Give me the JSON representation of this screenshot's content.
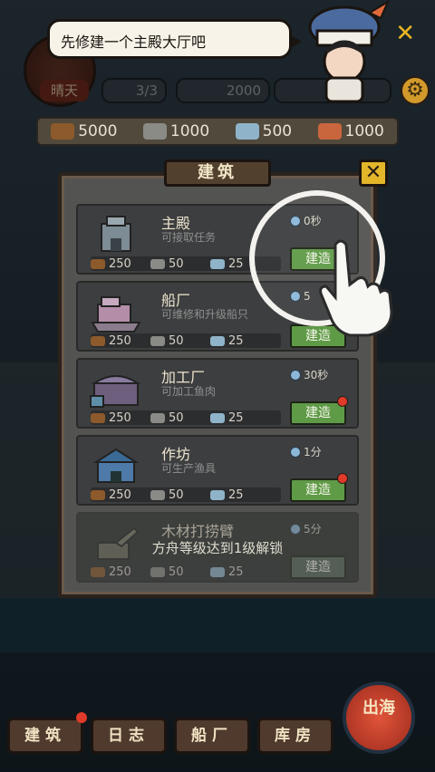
{
  "hud": {
    "weather": "晴天",
    "pill_values": [
      "3/3",
      "2000"
    ]
  },
  "resources": [
    {
      "icon": "wood-icon",
      "value": "5000"
    },
    {
      "icon": "stone-icon",
      "value": "1000"
    },
    {
      "icon": "iron-icon",
      "value": "500"
    },
    {
      "icon": "meat-icon",
      "value": "1000"
    }
  ],
  "tutorial": {
    "bubble_text": "先修建一个主殿大厅吧"
  },
  "panel": {
    "title": "建筑",
    "close_symbol": "✕",
    "locked_message": "方舟等级达到1级解锁",
    "buildings": [
      {
        "name": "主殿",
        "desc": "可接取任务",
        "time": "0秒",
        "wood": "250",
        "stone": "50",
        "iron": "25",
        "button": "建造"
      },
      {
        "name": "船厂",
        "desc": "可维修和升级船只",
        "time": "5",
        "wood": "250",
        "stone": "50",
        "iron": "25",
        "button": "建造"
      },
      {
        "name": "加工厂",
        "desc": "可加工鱼肉",
        "time": "30秒",
        "wood": "250",
        "stone": "50",
        "iron": "25",
        "button": "建造"
      },
      {
        "name": "作坊",
        "desc": "可生产渔具",
        "time": "1分",
        "wood": "250",
        "stone": "50",
        "iron": "25",
        "button": "建造"
      },
      {
        "name": "木材打捞臂",
        "desc": "",
        "time": "5分",
        "wood": "250",
        "stone": "50",
        "iron": "25",
        "button": "建造"
      }
    ]
  },
  "nav": {
    "items": [
      "建筑",
      "日志",
      "船厂",
      "库房"
    ],
    "sail": "出海"
  },
  "colors": {
    "build_button": "#5f9a47",
    "alert_dot": "#e03a2a",
    "accent_gold": "#e3b62a"
  }
}
